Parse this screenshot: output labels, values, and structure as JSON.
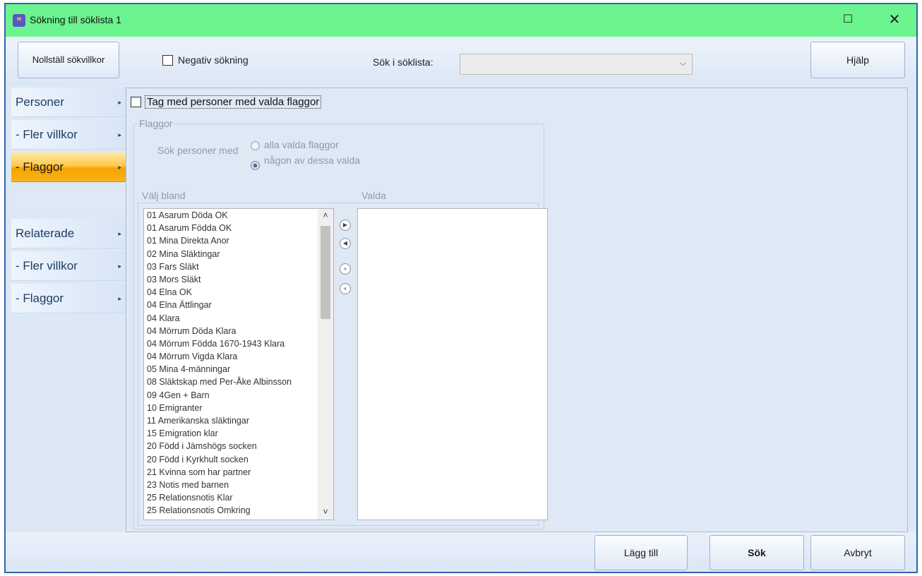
{
  "window": {
    "title": "Sökning till söklista 1",
    "icon": "app-icon",
    "minimize_glyph": "—",
    "maximize_glyph": "☐",
    "close_glyph": "✕"
  },
  "toolbar": {
    "reset_label": "Nollställ sökvillkor",
    "negative_search_label": "Negativ sökning",
    "negative_search_checked": false,
    "search_in_list_label": "Sök i söklista:",
    "search_in_list_value": "",
    "help_label": "Hjälp"
  },
  "nav": {
    "items": [
      {
        "label": "Personer",
        "active": false
      },
      {
        "label": "- Fler villkor",
        "active": false
      },
      {
        "label": "- Flaggor",
        "active": true
      },
      {
        "label": "Relaterade",
        "active": false
      },
      {
        "label": "- Fler villkor",
        "active": false
      },
      {
        "label": "- Flaggor",
        "active": false
      }
    ],
    "arrow_glyph": "▸"
  },
  "flags": {
    "include_label": "Tag med personer med valda flaggor",
    "include_checked": false,
    "group_title": "Flaggor",
    "search_persons_label": "Sök personer med",
    "option_all": "alla valda flaggor",
    "option_any": "någon av dessa valda",
    "selected_option": "any",
    "choose_from_label": "Välj bland",
    "selected_label": "Valda",
    "available": [
      "01 Asarum Döda OK",
      "01 Asarum Födda OK",
      "01 Mina Direkta Anor",
      "02 Mina Släktingar",
      "03 Fars Släkt",
      "03 Mors Släkt",
      "04 Elna OK",
      "04 Elna Ättlingar",
      "04 Klara",
      "04 Mörrum Döda Klara",
      "04 Mörrum Födda 1670-1943 Klara",
      "04 Mörrum Vigda Klara",
      "05 Mina 4-männingar",
      "08 Släktskap med Per-Åke Albinsson",
      "09 4Gen + Barn",
      "10 Emigranter",
      "11 Amerikanska släktingar",
      "15 Emigration klar",
      "20 Född i Jämshögs socken",
      "20 Född i Kyrkhult socken",
      "21 Kvinna som har partner",
      "23 Notis med barnen",
      "25 Relationsnotis Klar",
      "25 Relationsnotis Omkring"
    ],
    "selected": []
  },
  "bottom": {
    "add_label": "Lägg till",
    "search_label": "Sök",
    "cancel_label": "Avbryt"
  },
  "colors": {
    "titlebar": "#6cf48f",
    "active_nav": "#f7a400",
    "window_border": "#2f64b0"
  }
}
